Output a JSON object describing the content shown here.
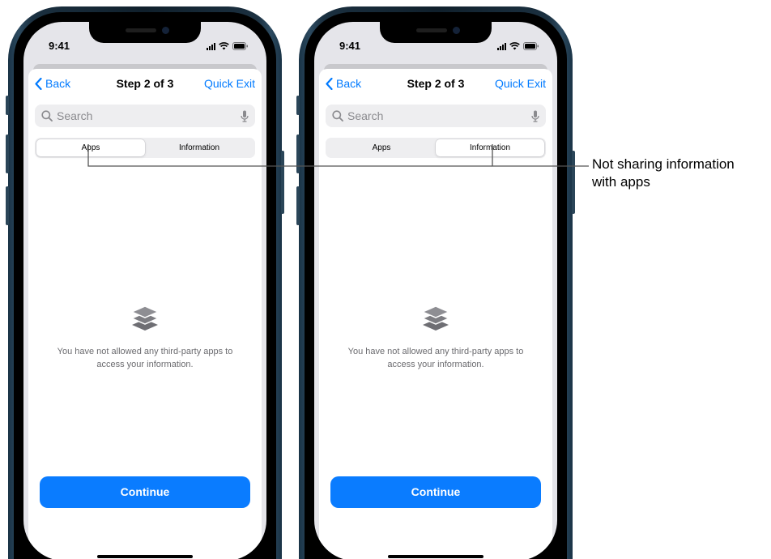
{
  "phones": [
    {
      "status_time": "9:41",
      "nav": {
        "back_label": "Back",
        "title": "Step 2 of 3",
        "exit_label": "Quick Exit"
      },
      "search": {
        "placeholder": "Search"
      },
      "segments": [
        "Apps",
        "Information"
      ],
      "selected_segment": "Apps",
      "empty_message": "You have not allowed any third-party apps to access your information.",
      "continue_label": "Continue"
    },
    {
      "status_time": "9:41",
      "nav": {
        "back_label": "Back",
        "title": "Step 2 of 3",
        "exit_label": "Quick Exit"
      },
      "search": {
        "placeholder": "Search"
      },
      "segments": [
        "Apps",
        "Information"
      ],
      "selected_segment": "Information",
      "empty_message": "You have not allowed any third-party apps to access your information.",
      "continue_label": "Continue"
    }
  ],
  "callout": {
    "line1": "Not sharing information",
    "line2": "with apps"
  },
  "icons": [
    "chevron-left-icon",
    "magnifier-icon",
    "microphone-icon",
    "cellular-signal-icon",
    "wifi-icon",
    "battery-icon",
    "stacked-layers-icon"
  ],
  "colors": {
    "accent": "#0a7cff",
    "link": "#007aff",
    "frame": "#1b3040"
  }
}
